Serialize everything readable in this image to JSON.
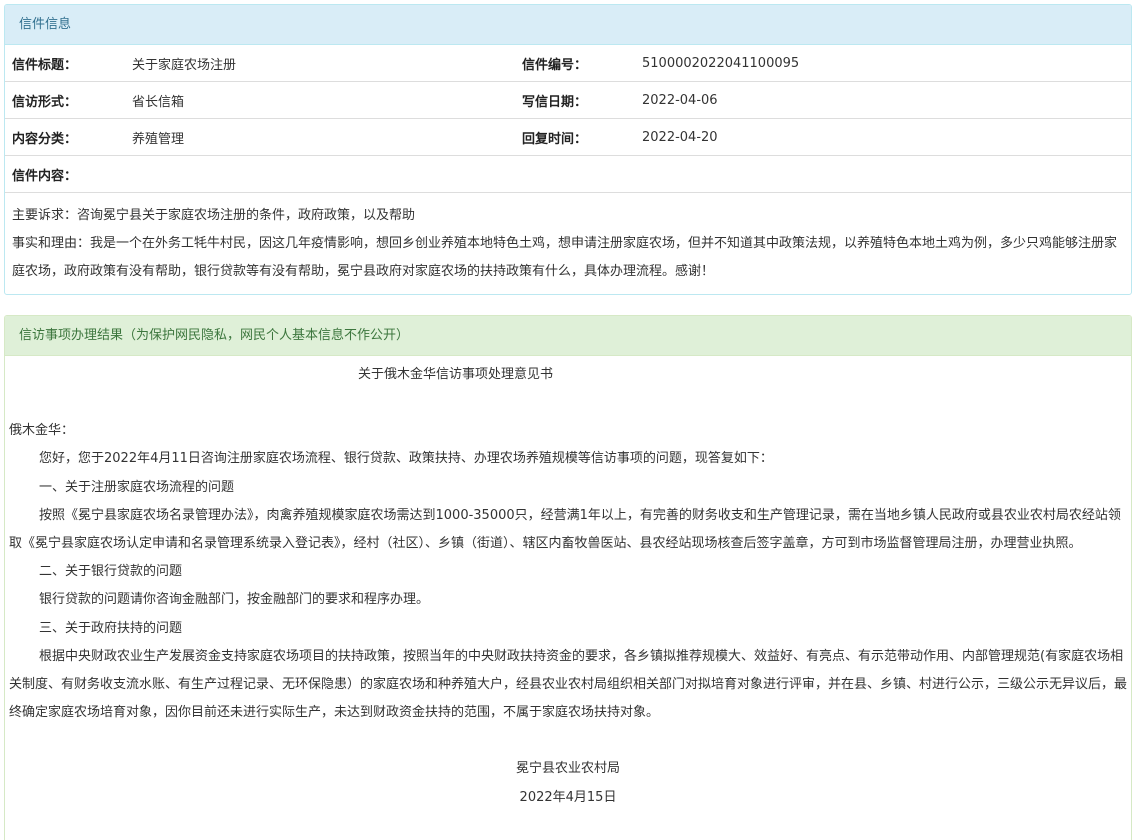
{
  "letter_info": {
    "heading": "信件信息",
    "title_label": "信件标题：",
    "title_value": "关于家庭农场注册",
    "number_label": "信件编号：",
    "number_value": "5100002022041100095",
    "form_label": "信访形式：",
    "form_value": "省长信箱",
    "date_label": "写信日期：",
    "date_value": "2022-04-06",
    "category_label": "内容分类：",
    "category_value": "养殖管理",
    "reply_time_label": "回复时间：",
    "reply_time_value": "2022-04-20",
    "content_label": "信件内容：",
    "content_lines": [
      "主要诉求：咨询冕宁县关于家庭农场注册的条件，政府政策，以及帮助",
      "事实和理由：我是一个在外务工牦牛村民，因这几年疫情影响，想回乡创业养殖本地特色土鸡，想申请注册家庭农场，但并不知道其中政策法规，以养殖特色本地土鸡为例，多少只鸡能够注册家庭农场，政府政策有没有帮助，银行贷款等有没有帮助，冕宁县政府对家庭农场的扶持政策有什么，具体办理流程。感谢！"
    ]
  },
  "result": {
    "heading": "信访事项办理结果（为保护网民隐私，网民个人基本信息不作公开）",
    "doc_title": "关于俄木金华信访事项处理意见书",
    "salutation": "俄木金华：",
    "paragraphs": [
      "您好，您于2022年4月11日咨询注册家庭农场流程、银行贷款、政策扶持、办理农场养殖规模等信访事项的问题，现答复如下：",
      "一、关于注册家庭农场流程的问题",
      "按照《冕宁县家庭农场名录管理办法》，肉禽养殖规模家庭农场需达到1000-35000只，经营满1年以上，有完善的财务收支和生产管理记录，需在当地乡镇人民政府或县农业农村局农经站领取《冕宁县家庭农场认定申请和名录管理系统录入登记表》，经村（社区）、乡镇（街道）、辖区内畜牧兽医站、县农经站现场核查后签字盖章，方可到市场监督管理局注册，办理营业执照。",
      "二、关于银行贷款的问题",
      "银行贷款的问题请你咨询金融部门，按金融部门的要求和程序办理。",
      "三、关于政府扶持的问题",
      "根据中央财政农业生产发展资金支持家庭农场项目的扶持政策，按照当年的中央财政扶持资金的要求，各乡镇拟推荐规模大、效益好、有亮点、有示范带动作用、内部管理规范(有家庭农场相关制度、有财务收支流水账、有生产过程记录、无环保隐患）的家庭农场和种养殖大户，经县农业农村局组织相关部门对拟培育对象进行评审，并在县、乡镇、村进行公示，三级公示无异议后，最终确定家庭农场培育对象，因你目前还未进行实际生产，未达到财政资金扶持的范围，不属于家庭农场扶持对象。"
    ],
    "signature": "冕宁县农业农村局",
    "sign_date": "2022年4月15日"
  }
}
